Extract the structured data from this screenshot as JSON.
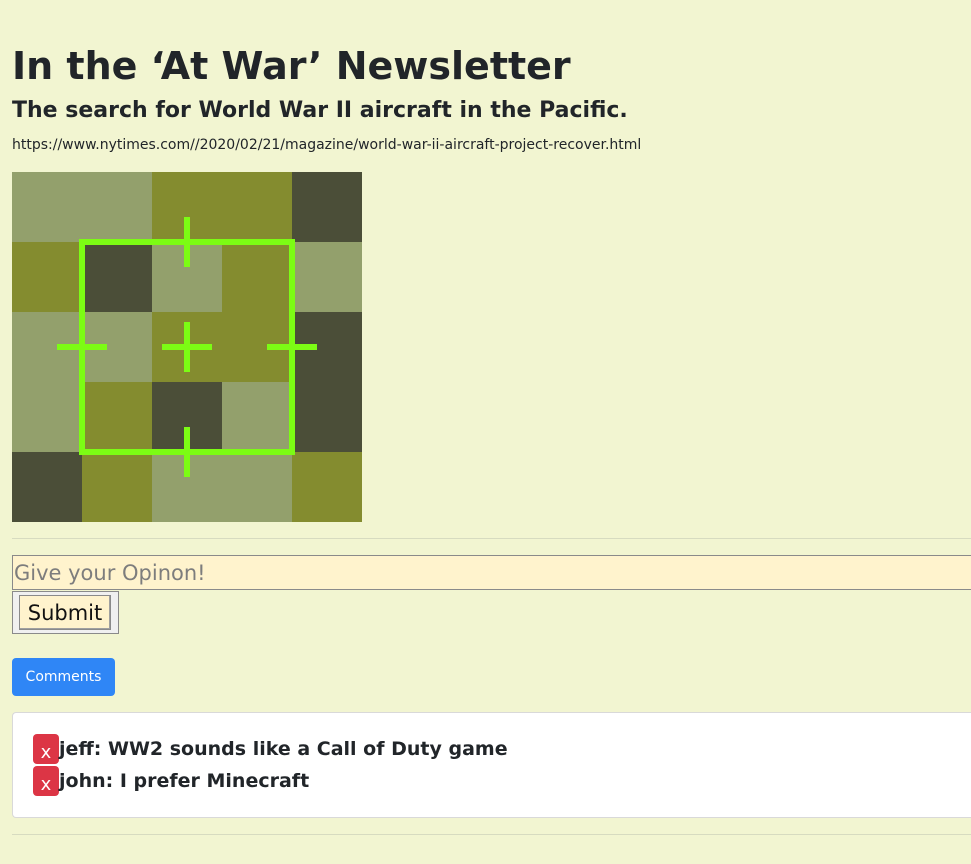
{
  "article": {
    "title": "In the ‘At War’ Newsletter",
    "subtitle": "The search for World War II aircraft in the Pacific.",
    "url": "https://www.nytimes.com//2020/02/21/magazine/world-war-ii-aircraft-project-recover.html",
    "image_icon": "target-crosshair-icon"
  },
  "opinion_form": {
    "placeholder": "Give your Opinon!",
    "value": "",
    "submit_label": "Submit"
  },
  "comments_section": {
    "toggle_label": "Comments",
    "items": [
      {
        "delete_label": "x",
        "text": "jeff: WW2 sounds like a Call of Duty game"
      },
      {
        "delete_label": "x",
        "text": "john: I prefer Minecraft"
      }
    ]
  },
  "colors": {
    "page_background": "#f2f5d1",
    "input_background": "#fff3cd",
    "comments_button": "#2f86f6",
    "delete_button": "#dc3545",
    "crosshair": "#7cfc14"
  }
}
